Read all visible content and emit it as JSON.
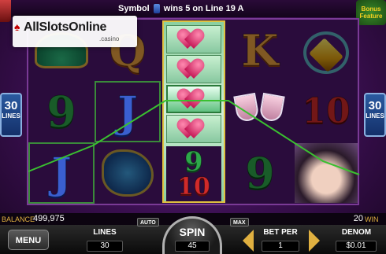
{
  "top_bar": {
    "message_prefix": "Symbol",
    "message_suffix": "wins 5 on Line 19 A"
  },
  "logo": {
    "brand": "AllSlotsOnline",
    "suffix": ".casino"
  },
  "bonus_badge": "Bonus Feature",
  "lines_indicator": {
    "number": "30",
    "label": "LINES"
  },
  "reels": {
    "reel1": [
      "tiara-symbol",
      "9",
      "J"
    ],
    "reel2": [
      "Q",
      "J",
      "glove-symbol"
    ],
    "reel3": [
      "heart-ring-symbol",
      "heart-ring-symbol",
      "heart-ring-symbol",
      "heart-ring-symbol",
      "9",
      "10"
    ],
    "reel4": [
      "K",
      "champagne-glasses-symbol",
      "9"
    ],
    "reel5": [
      "crown-diamond-symbol",
      "10",
      "mask-symbol"
    ]
  },
  "reel_glyphs": {
    "r1c1": "9",
    "r1c2": "J",
    "r2c0": "Q",
    "r2c1": "J",
    "r3_nine": "9",
    "r3_ten": "10",
    "r4c0": "K",
    "r4c2": "9",
    "r5c1": "10"
  },
  "info": {
    "balance_label": "BALANCE",
    "balance_value": "499,975",
    "win_value": "20",
    "win_label": "WIN"
  },
  "controls": {
    "menu_label": "MENU",
    "lines_label": "LINES",
    "lines_value": "30",
    "auto_label": "AUTO",
    "spin_label": "SPIN",
    "spin_value": "45",
    "max_label": "MAX",
    "bet_per_label": "BET PER",
    "bet_per_value": "1",
    "denom_label": "DENOM",
    "denom_value": "$0.01"
  },
  "colors": {
    "payline": "#3ac030",
    "accent": "#e0b040"
  }
}
